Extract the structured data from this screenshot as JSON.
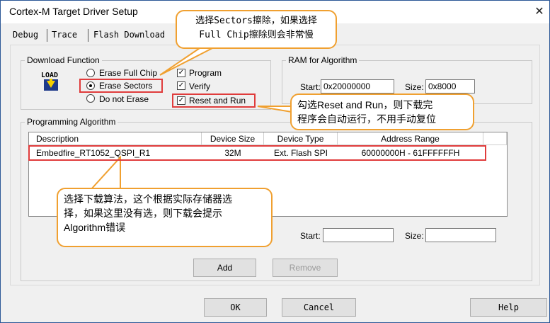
{
  "window": {
    "title": "Cortex-M Target Driver Setup",
    "close_glyph": "✕"
  },
  "tabs": [
    {
      "label": "Debug"
    },
    {
      "label": "Trace"
    },
    {
      "label": "Flash Download"
    }
  ],
  "download_function": {
    "legend": "Download Function",
    "icon_text": "LOAD",
    "radios": [
      {
        "label": "Erase Full Chip",
        "selected": false
      },
      {
        "label": "Erase Sectors",
        "selected": true
      },
      {
        "label": "Do not Erase",
        "selected": false
      }
    ],
    "checks": [
      {
        "label": "Program",
        "checked": true
      },
      {
        "label": "Verify",
        "checked": true
      },
      {
        "label": "Reset and Run",
        "checked": true
      }
    ],
    "check_glyph": "✓"
  },
  "ram": {
    "legend": "RAM for Algorithm",
    "start_label": "Start:",
    "start_value": "0x20000000",
    "size_label": "Size:",
    "size_value": "0x8000"
  },
  "programming": {
    "legend": "Programming Algorithm",
    "columns": [
      "Description",
      "Device Size",
      "Device Type",
      "Address Range"
    ],
    "rows": [
      {
        "description": "Embedfire_RT1052_QSPI_R1",
        "size": "32M",
        "type": "Ext. Flash SPI",
        "range": "60000000H - 61FFFFFFH"
      }
    ],
    "start_label": "Start:",
    "start_value": "",
    "size_label": "Size:",
    "size_value": "",
    "add_label": "Add",
    "remove_label": "Remove"
  },
  "footer": {
    "ok_label": "OK",
    "cancel_label": "Cancel",
    "help_label": "Help"
  },
  "callouts": {
    "sectors_line1": "选择Sectors擦除，如果选择",
    "sectors_line2": "Full Chip擦除则会非常慢",
    "reset_line1": "勾选Reset  and Run，则下载完",
    "reset_line2": "程序会自动运行，不用手动复位",
    "algo_line1": "选择下载算法，这个根据实际存储器选",
    "algo_line2": "择，如果这里没有选，则下载会提示",
    "algo_line3": "Algorithm错误"
  },
  "colors": {
    "highlight": "#e03c3c",
    "callout_border": "#f0a030",
    "window_border": "#2b5797"
  }
}
